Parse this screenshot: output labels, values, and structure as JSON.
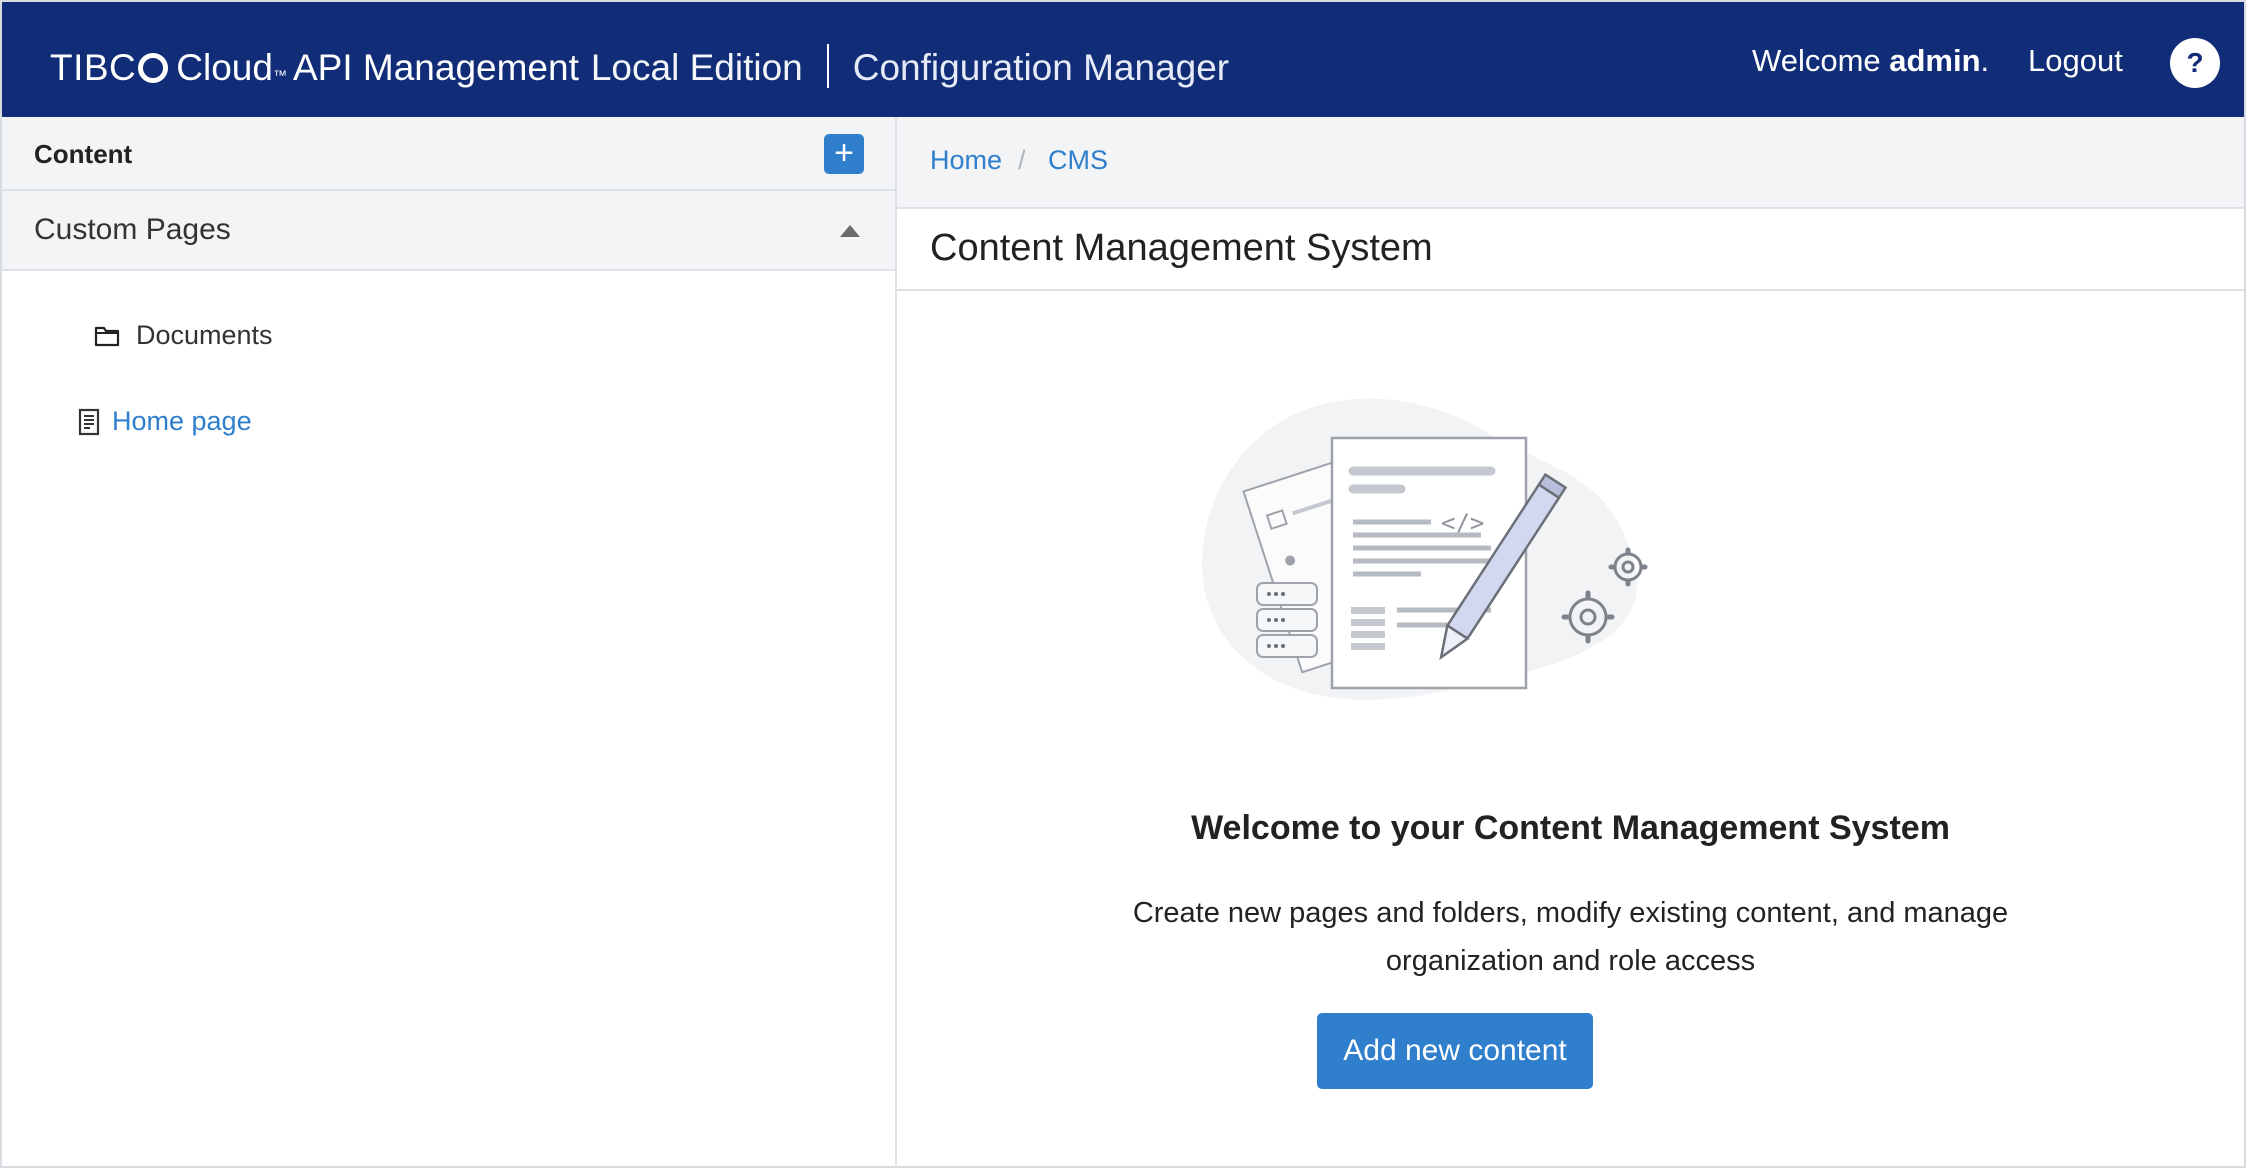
{
  "header": {
    "brand_company": "TIBC",
    "brand_product": "Cloud",
    "brand_tm": "™",
    "brand_product_name": "API Management",
    "brand_edition": "Local Edition",
    "app_name": "Configuration Manager",
    "welcome_prefix": "Welcome ",
    "welcome_user": "admin",
    "welcome_suffix": ".",
    "logout_label": "Logout",
    "help_label": "?"
  },
  "sidebar": {
    "title": "Content",
    "add_label": "+",
    "section_label": "Custom Pages",
    "items": [
      {
        "label": "Documents",
        "icon": "folder-icon"
      },
      {
        "label": "Home page",
        "icon": "document-icon"
      }
    ]
  },
  "breadcrumb": {
    "items": [
      "Home",
      "CMS"
    ],
    "separator": "/"
  },
  "main": {
    "page_title": "Content Management System",
    "welcome_title": "Welcome to your Content Management System",
    "welcome_desc_line1": "Create new pages and folders, modify existing content, and manage",
    "welcome_desc_line2": "organization and role access",
    "add_button_label": "Add new content"
  },
  "colors": {
    "header_bg": "#112d77",
    "accent": "#2f7fcc",
    "panel_bg": "#f3f4f5"
  }
}
